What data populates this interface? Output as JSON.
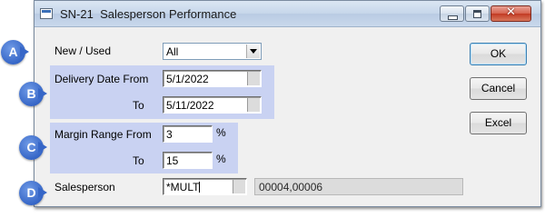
{
  "window": {
    "title": "SN-21  Salesperson Performance"
  },
  "fields": {
    "new_used_label": "New / Used",
    "new_used_value": "All",
    "delivery_from_label": "Delivery Date From",
    "delivery_from_value": "5/1/2022",
    "delivery_to_label": "To",
    "delivery_to_value": "5/11/2022",
    "margin_from_label": "Margin Range From",
    "margin_from_value": "3",
    "margin_to_label": "To",
    "margin_to_value": "15",
    "percent_symbol": "%",
    "salesperson_label": "Salesperson",
    "salesperson_value": "*MULT",
    "salesperson_list": "00004,00006"
  },
  "buttons": {
    "ok": "OK",
    "cancel": "Cancel",
    "excel": "Excel"
  },
  "callouts": [
    "A",
    "B",
    "C",
    "D"
  ],
  "colors": {
    "group_highlight": "#c9d2f2",
    "callout_blue": "#3666c7",
    "close_red": "#c23a23"
  }
}
